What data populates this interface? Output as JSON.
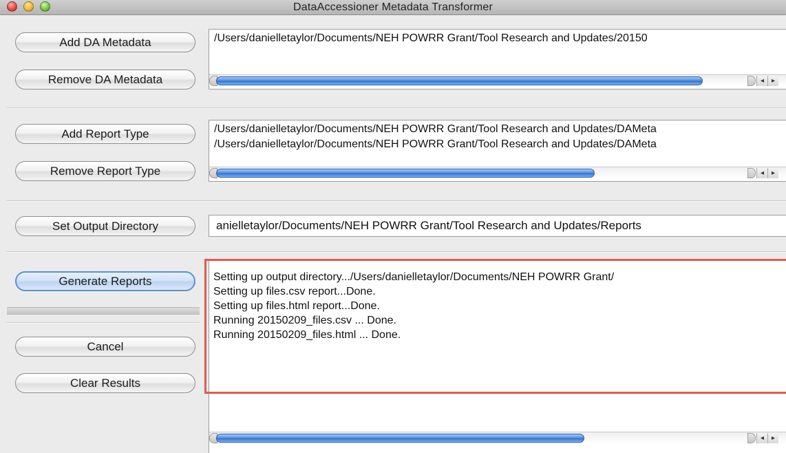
{
  "window": {
    "title": "DataAccessioner Metadata Transformer"
  },
  "buttons": {
    "add_da_metadata": "Add DA Metadata",
    "remove_da_metadata": "Remove DA Metadata",
    "add_report_type": "Add Report Type",
    "remove_report_type": "Remove Report Type",
    "set_output_directory": "Set Output Directory",
    "generate_reports": "Generate Reports",
    "cancel": "Cancel",
    "clear_results": "Clear Results"
  },
  "metadata_list": {
    "items": [
      "/Users/danielletaylor/Documents/NEH POWRR Grant/Tool Research and Updates/20150"
    ]
  },
  "report_type_list": {
    "items": [
      "/Users/danielletaylor/Documents/NEH POWRR Grant/Tool Research and Updates/DAMeta",
      "/Users/danielletaylor/Documents/NEH POWRR Grant/Tool Research and Updates/DAMeta"
    ]
  },
  "output_directory": {
    "value": "anielletaylor/Documents/NEH POWRR Grant/Tool Research and Updates/Reports"
  },
  "results": {
    "lines": [
      "Setting up output directory.../Users/danielletaylor/Documents/NEH POWRR Grant/",
      "Setting up files.csv report...Done.",
      "Setting up files.html report...Done.",
      "Running 20150209_files.csv ... Done.",
      "Running 20150209_files.html ... Done."
    ]
  },
  "scroll_arrows": {
    "left": "◂",
    "right": "▸"
  },
  "colors": {
    "highlight_border": "#e05a4e",
    "scroll_thumb": "#2a6fd1",
    "default_button_border": "#5b8fd6"
  }
}
